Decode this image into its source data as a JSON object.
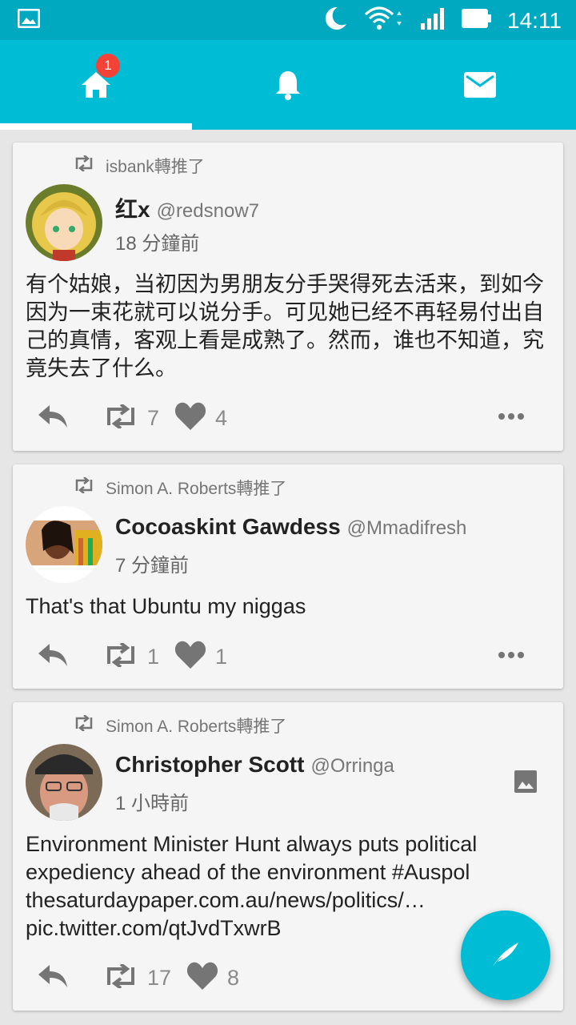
{
  "status": {
    "time": "14:11"
  },
  "tabs": {
    "home_badge": "1"
  },
  "tweets": [
    {
      "retweeted_by": "isbank轉推了",
      "name": "红x",
      "handle": "@redsnow7",
      "time": "18 分鐘前",
      "text": "有个姑娘，当初因为男朋友分手哭得死去活来，到如今因为一束花就可以说分手。可见她已经不再轻易付出自己的真情，客观上看是成熟了。然而，谁也不知道，究竟失去了什么。",
      "retweets": "7",
      "likes": "4"
    },
    {
      "retweeted_by": "Simon A. Roberts轉推了",
      "name": "Cocoaskint Gawdess",
      "handle": "@Mmadifresh",
      "time": "7 分鐘前",
      "text": "That's that Ubuntu my niggas",
      "retweets": "1",
      "likes": "1"
    },
    {
      "retweeted_by": "Simon A. Roberts轉推了",
      "name": "Christopher Scott",
      "handle": "@Orringa",
      "time": "1 小時前",
      "text_line1": "Environment Minister Hunt always puts political",
      "text_line2": "expediency ahead of the environment #Auspol",
      "text_line3": "thesaturdaypaper.com.au/news/politics/…",
      "text_line4": "pic.twitter.com/qtJvdTxwrB",
      "retweets": "17",
      "likes": "8"
    }
  ]
}
